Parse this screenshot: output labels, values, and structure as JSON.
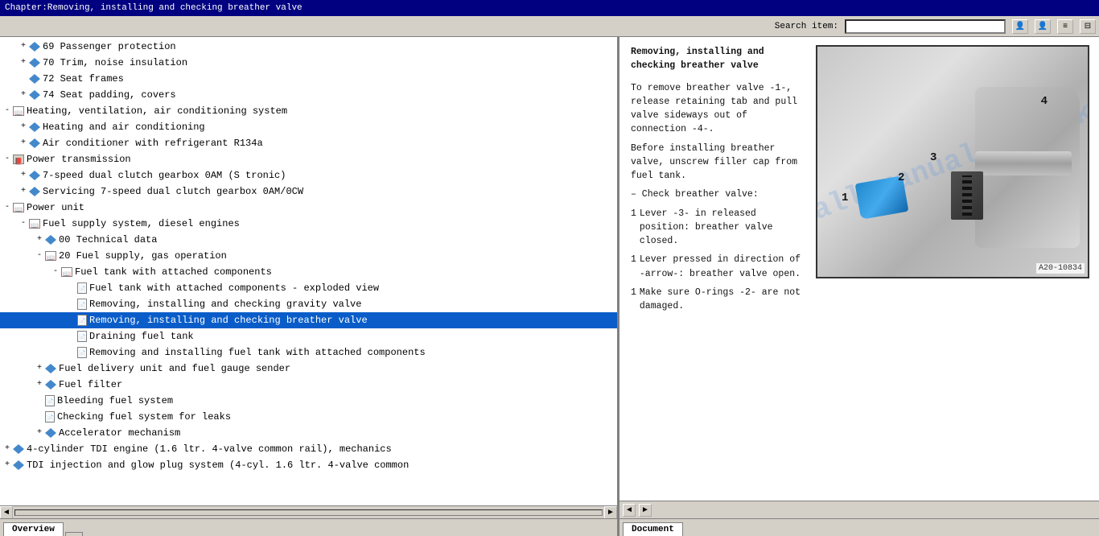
{
  "titlebar": {
    "text": "Chapter:Removing, installing and checking breather valve"
  },
  "toolbar": {
    "search_label": "Search item:",
    "search_placeholder": ""
  },
  "tree": {
    "items": [
      {
        "id": 1,
        "indent": 1,
        "expander": "+",
        "icon": "folder",
        "text": "69  Passenger protection",
        "level": 1
      },
      {
        "id": 2,
        "indent": 1,
        "expander": "+",
        "icon": "folder",
        "text": "70  Trim, noise insulation",
        "level": 1
      },
      {
        "id": 3,
        "indent": 1,
        "expander": " ",
        "icon": "folder",
        "text": "72  Seat frames",
        "level": 1
      },
      {
        "id": 4,
        "indent": 1,
        "expander": "+",
        "icon": "folder",
        "text": "74  Seat padding, covers",
        "level": 1
      },
      {
        "id": 5,
        "indent": 0,
        "expander": "-",
        "icon": "book-open",
        "text": "Heating, ventilation, air conditioning system",
        "level": 0
      },
      {
        "id": 6,
        "indent": 1,
        "expander": "+",
        "icon": "folder",
        "text": "Heating and air conditioning",
        "level": 1
      },
      {
        "id": 7,
        "indent": 1,
        "expander": "+",
        "icon": "folder",
        "text": "Air conditioner with refrigerant R134a",
        "level": 1
      },
      {
        "id": 8,
        "indent": 0,
        "expander": "-",
        "icon": "book-closed",
        "text": "Power transmission",
        "level": 0
      },
      {
        "id": 9,
        "indent": 1,
        "expander": "+",
        "icon": "folder",
        "text": "7-speed dual clutch gearbox 0AM (S tronic)",
        "level": 1
      },
      {
        "id": 10,
        "indent": 1,
        "expander": "+",
        "icon": "folder",
        "text": "Servicing 7-speed dual clutch gearbox 0AM/0CW",
        "level": 1
      },
      {
        "id": 11,
        "indent": 0,
        "expander": "-",
        "icon": "book-open",
        "text": "Power unit",
        "level": 0
      },
      {
        "id": 12,
        "indent": 1,
        "expander": "-",
        "icon": "book-open",
        "text": "Fuel supply system, diesel engines",
        "level": 1
      },
      {
        "id": 13,
        "indent": 2,
        "expander": "+",
        "icon": "folder",
        "text": "00  Technical data",
        "level": 2
      },
      {
        "id": 14,
        "indent": 2,
        "expander": "-",
        "icon": "book-open",
        "text": "20  Fuel supply, gas operation",
        "level": 2
      },
      {
        "id": 15,
        "indent": 3,
        "expander": "-",
        "icon": "book-open",
        "text": "Fuel tank with attached components",
        "level": 3
      },
      {
        "id": 16,
        "indent": 4,
        "expander": " ",
        "icon": "doc",
        "text": "Fuel tank with attached components - exploded view",
        "level": 4
      },
      {
        "id": 17,
        "indent": 4,
        "expander": " ",
        "icon": "doc",
        "text": "Removing, installing and checking gravity valve",
        "level": 4
      },
      {
        "id": 18,
        "indent": 4,
        "expander": " ",
        "icon": "doc",
        "text": "Removing, installing and checking breather valve",
        "level": 4,
        "selected": true
      },
      {
        "id": 19,
        "indent": 4,
        "expander": " ",
        "icon": "doc",
        "text": "Draining fuel tank",
        "level": 4
      },
      {
        "id": 20,
        "indent": 4,
        "expander": " ",
        "icon": "doc",
        "text": "Removing and installing fuel tank with attached components",
        "level": 4
      },
      {
        "id": 21,
        "indent": 2,
        "expander": "+",
        "icon": "folder",
        "text": "Fuel delivery unit and fuel gauge sender",
        "level": 2
      },
      {
        "id": 22,
        "indent": 2,
        "expander": "+",
        "icon": "folder",
        "text": "Fuel filter",
        "level": 2
      },
      {
        "id": 23,
        "indent": 2,
        "expander": " ",
        "icon": "doc",
        "text": "Bleeding fuel system",
        "level": 2
      },
      {
        "id": 24,
        "indent": 2,
        "expander": " ",
        "icon": "doc",
        "text": "Checking fuel system for leaks",
        "level": 2
      },
      {
        "id": 25,
        "indent": 2,
        "expander": "+",
        "icon": "folder",
        "text": "Accelerator mechanism",
        "level": 2
      },
      {
        "id": 26,
        "indent": 0,
        "expander": "+",
        "icon": "folder",
        "text": "4-cylinder TDI engine (1.6 ltr. 4-valve common rail), mechanics",
        "level": 0
      },
      {
        "id": 27,
        "indent": 0,
        "expander": "+",
        "icon": "folder",
        "text": "TDI injection and glow plug system (4-cyl. 1.6 ltr. 4-valve common",
        "level": 0
      }
    ]
  },
  "left_tabs": [
    {
      "label": "Overview",
      "active": true
    },
    {
      "label": "",
      "active": false
    }
  ],
  "doc": {
    "title": "Removing, installing and checking breather valve",
    "para1": "To remove breather valve -1-, release retaining tab and pull valve sideways out of connection -4-.",
    "para2": "Before installing breather valve, unscrew filler cap from fuel tank.",
    "para3": "– Check breather valve:",
    "para4_label": "1",
    "para4": "Lever -3- in released position: breather valve closed.",
    "para5_label": "1",
    "para5": "Lever pressed in direction of -arrow-: breather valve open.",
    "para6_label": "1",
    "para6": "Make sure O-rings -2- are not damaged.",
    "image_id": "A20-10834",
    "watermark": "allymanuals.co.uk"
  },
  "right_tabs": [
    {
      "label": "Document",
      "active": true
    }
  ],
  "buttons": {
    "user1": "👤",
    "user2": "👤",
    "menu1": "☰",
    "menu2": "⊟",
    "nav_left": "◄",
    "nav_right": "►",
    "nav_left2": "◄",
    "nav_right2": "►"
  }
}
